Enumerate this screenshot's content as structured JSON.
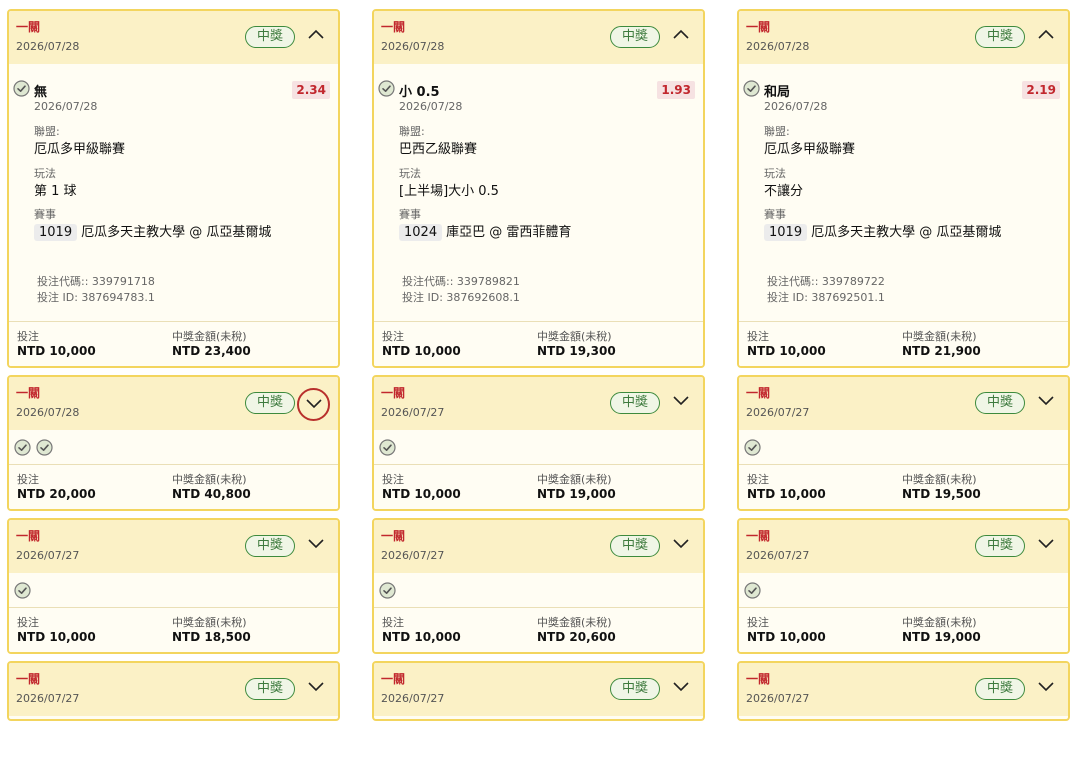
{
  "labels": {
    "category": "一關",
    "badge": "中獎",
    "league_label": "聯盟:",
    "play_label": "玩法",
    "event_label": "賽事",
    "stake_label": "投注",
    "payout_label": "中獎金額(未稅)"
  },
  "columns": [
    {
      "cards": [
        {
          "date": "2026/07/28",
          "expanded": true,
          "detail": {
            "pick": "無",
            "odds": "2.34",
            "date": "2026/07/28",
            "league": "厄瓜多甲級聯賽",
            "play": "第 1 球",
            "match_id": "1019",
            "match": "厄瓜多天主教大學 @ 瓜亞基爾城",
            "bet_code": "投注代碼:: 339791718",
            "bet_id": "投注 ID: 387694783.1"
          },
          "stake": "NTD 10,000",
          "payout": "NTD 23,400"
        },
        {
          "date": "2026/07/28",
          "checks": 2,
          "highlight": true,
          "stake": "NTD 20,000",
          "payout": "NTD 40,800"
        },
        {
          "date": "2026/07/27",
          "checks": 1,
          "stake": "NTD 10,000",
          "payout": "NTD 18,500"
        },
        {
          "date": "2026/07/27",
          "partial": true
        }
      ]
    },
    {
      "cards": [
        {
          "date": "2026/07/28",
          "expanded": true,
          "detail": {
            "pick": "小 0.5",
            "odds": "1.93",
            "date": "2026/07/28",
            "league": "巴西乙級聯賽",
            "play": "[上半場]大小 0.5",
            "match_id": "1024",
            "match": "庫亞巴 @ 雷西菲體育",
            "bet_code": "投注代碼:: 339789821",
            "bet_id": "投注 ID: 387692608.1"
          },
          "stake": "NTD 10,000",
          "payout": "NTD 19,300"
        },
        {
          "date": "2026/07/27",
          "checks": 1,
          "stake": "NTD 10,000",
          "payout": "NTD 19,000"
        },
        {
          "date": "2026/07/27",
          "checks": 1,
          "stake": "NTD 10,000",
          "payout": "NTD 20,600"
        },
        {
          "date": "2026/07/27",
          "partial": true
        }
      ]
    },
    {
      "cards": [
        {
          "date": "2026/07/28",
          "expanded": true,
          "detail": {
            "pick": "和局",
            "odds": "2.19",
            "date": "2026/07/28",
            "league": "厄瓜多甲級聯賽",
            "play": "不讓分",
            "match_id": "1019",
            "match": "厄瓜多天主教大學 @ 瓜亞基爾城",
            "bet_code": "投注代碼:: 339789722",
            "bet_id": "投注 ID: 387692501.1"
          },
          "stake": "NTD 10,000",
          "payout": "NTD 21,900"
        },
        {
          "date": "2026/07/27",
          "checks": 1,
          "stake": "NTD 10,000",
          "payout": "NTD 19,500"
        },
        {
          "date": "2026/07/27",
          "checks": 1,
          "stake": "NTD 10,000",
          "payout": "NTD 19,000"
        },
        {
          "date": "2026/07/27",
          "partial": true
        }
      ]
    }
  ],
  "colors": {
    "border": "#f3d55e",
    "header_bg": "#fbf1c6",
    "accent_red": "#c1272d",
    "badge_green": "#3d8a3d"
  },
  "icons": {
    "check": "check-circle-icon",
    "chevron_up": "chevron-up-icon",
    "chevron_down": "chevron-down-icon"
  }
}
